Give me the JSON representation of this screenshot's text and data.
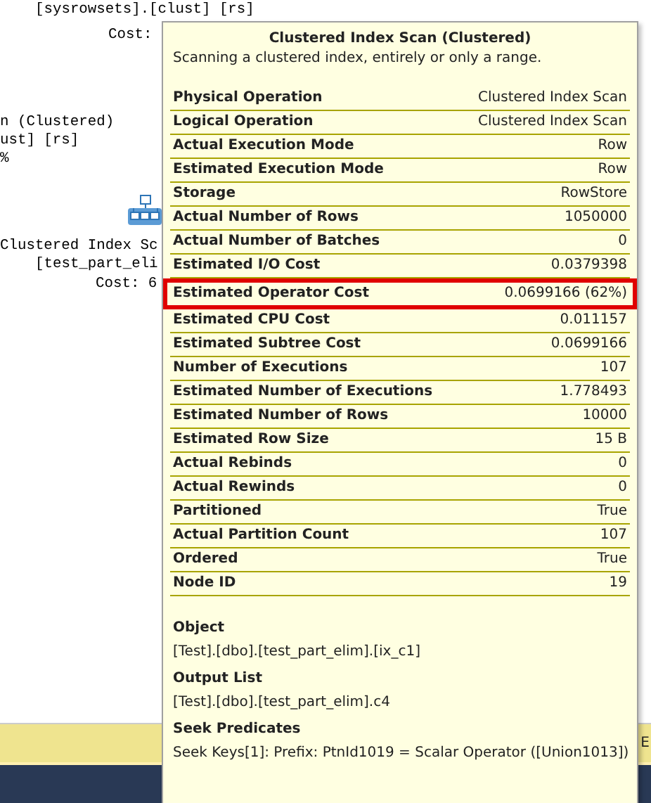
{
  "plan": {
    "texts": [
      "[sysrowsets].[clust] [rs]",
      "Cost:",
      "n (Clustered)",
      "ust] [rs]",
      "%",
      "Clustered Index Sc",
      "[test_part_eli",
      "Cost: 6"
    ]
  },
  "tooltip": {
    "title": "Clustered Index Scan (Clustered)",
    "description": "Scanning a clustered index, entirely or only a range.",
    "properties": [
      {
        "label": "Physical Operation",
        "value": "Clustered Index Scan",
        "highlighted": false
      },
      {
        "label": "Logical Operation",
        "value": "Clustered Index Scan",
        "highlighted": false
      },
      {
        "label": "Actual Execution Mode",
        "value": "Row",
        "highlighted": false
      },
      {
        "label": "Estimated Execution Mode",
        "value": "Row",
        "highlighted": false
      },
      {
        "label": "Storage",
        "value": "RowStore",
        "highlighted": false
      },
      {
        "label": "Actual Number of Rows",
        "value": "1050000",
        "highlighted": false
      },
      {
        "label": "Actual Number of Batches",
        "value": "0",
        "highlighted": false
      },
      {
        "label": "Estimated I/O Cost",
        "value": "0.0379398",
        "highlighted": false
      },
      {
        "label": "Estimated Operator Cost",
        "value": "0.0699166 (62%)",
        "highlighted": true
      },
      {
        "label": "Estimated CPU Cost",
        "value": "0.011157",
        "highlighted": false
      },
      {
        "label": "Estimated Subtree Cost",
        "value": "0.0699166",
        "highlighted": false
      },
      {
        "label": "Number of Executions",
        "value": "107",
        "highlighted": false
      },
      {
        "label": "Estimated Number of Executions",
        "value": "1.778493",
        "highlighted": false
      },
      {
        "label": "Estimated Number of Rows",
        "value": "10000",
        "highlighted": false
      },
      {
        "label": "Estimated Row Size",
        "value": "15 B",
        "highlighted": false
      },
      {
        "label": "Actual Rebinds",
        "value": "0",
        "highlighted": false
      },
      {
        "label": "Actual Rewinds",
        "value": "0",
        "highlighted": false
      },
      {
        "label": "Partitioned",
        "value": "True",
        "highlighted": false
      },
      {
        "label": "Actual Partition Count",
        "value": "107",
        "highlighted": false
      },
      {
        "label": "Ordered",
        "value": "True",
        "highlighted": false
      },
      {
        "label": "Node ID",
        "value": "19",
        "highlighted": false
      }
    ],
    "sections": [
      {
        "heading": "Object",
        "text": "[Test].[dbo].[test_part_elim].[ix_c1]"
      },
      {
        "heading": "Output List",
        "text": "[Test].[dbo].[test_part_elim].c4"
      },
      {
        "heading": "Seek Predicates",
        "text": "Seek Keys[1]: Prefix: PtnId1019 = Scalar Operator ([Union1013])"
      }
    ]
  },
  "status_bar": {
    "text": "E"
  }
}
